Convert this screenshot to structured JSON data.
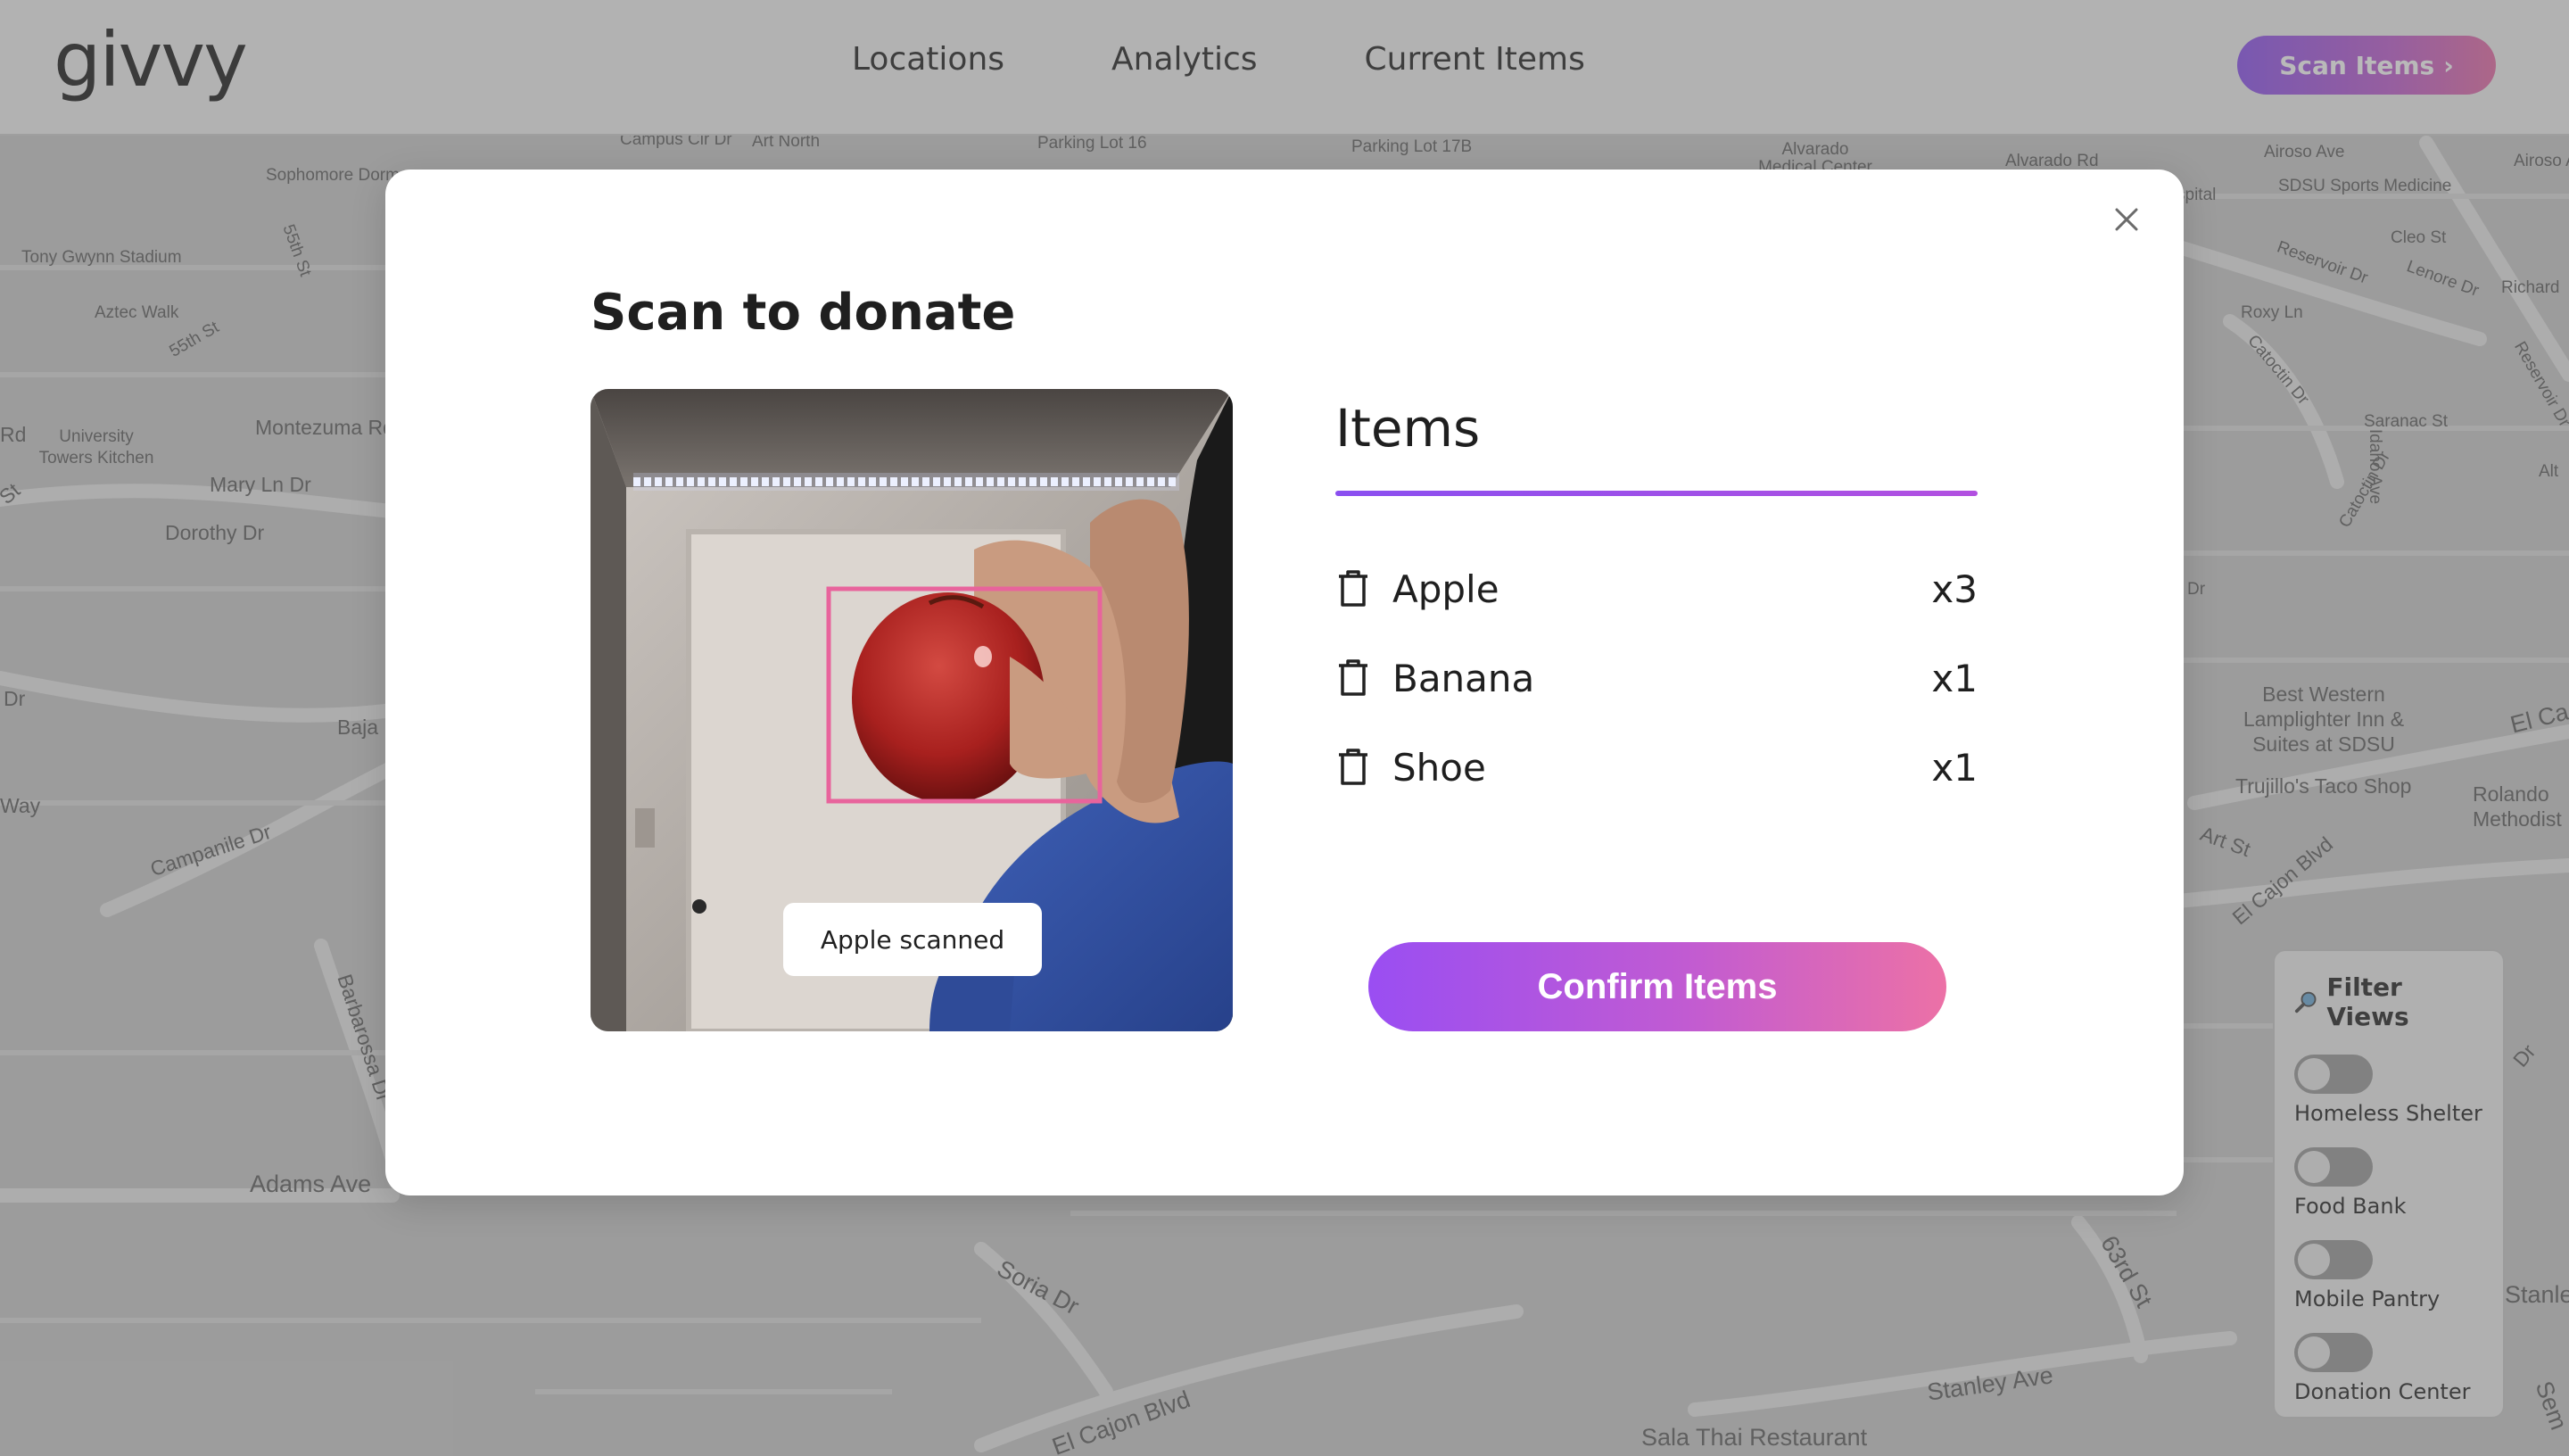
{
  "app": {
    "logo": "givvy"
  },
  "nav": {
    "items": [
      {
        "label": "Locations"
      },
      {
        "label": "Analytics"
      },
      {
        "label": "Current Items"
      }
    ]
  },
  "header": {
    "scan_button": "Scan Items",
    "scan_button_chevron": "›"
  },
  "map": {
    "labels": [
      "Campus Cir Dr",
      "Art North",
      "Parking Lot 16",
      "Parking Lot 17B",
      "Alvarado Medical Center",
      "Alvarado Rd",
      "Airoso Ave",
      "Airoso Ave",
      "Sophomore Dorm",
      "Tony Gwynn Stadium",
      "55th St",
      "Aztec Walk",
      "55th St",
      "University Towers Kitchen",
      "Montezuma Rd",
      "Mary Ln Dr",
      "Dorothy Dr",
      "Rd",
      "St",
      "Dr",
      "Way",
      "Baja Dr",
      "Campanile Dr",
      "Barbarossa Dr",
      "Adams Ave",
      "Soria Dr",
      "El Cajon Blvd",
      "Stanley Ave",
      "Sala Thai Restaurant",
      "63rd St",
      "SDSU Sports Medicine",
      "Cleo St",
      "Reservoir Dr",
      "Lenore Dr",
      "Richard",
      "Roxy Ln",
      "Catoctin Dr",
      "Saranac St",
      "Catoctin Dr",
      "Idaho Ave",
      "Reservoir Dr",
      "Alt",
      "Dr",
      "Best Western Lamplighter Inn & Suites at SDSU",
      "Trujillo's Taco Shop",
      "El Ca",
      "Rolando Methodist",
      "Art St",
      "El Cajon Blvd",
      "Dr",
      "Stanley",
      "Sem",
      "spital"
    ]
  },
  "filter": {
    "title": "Filter Views",
    "items": [
      {
        "label": "Homeless Shelter",
        "on": false
      },
      {
        "label": "Food Bank",
        "on": false
      },
      {
        "label": "Mobile Pantry",
        "on": false
      },
      {
        "label": "Donation Center",
        "on": false
      }
    ]
  },
  "modal": {
    "title": "Scan to donate",
    "toast": "Apple scanned",
    "items_heading": "Items",
    "items": [
      {
        "name": "Apple",
        "qty": "x3"
      },
      {
        "name": "Banana",
        "qty": "x1"
      },
      {
        "name": "Shoe",
        "qty": "x1"
      }
    ],
    "confirm_label": "Confirm Items"
  },
  "colors": {
    "accent_purple": "#8a4ff0",
    "accent_pink": "#e86aa6",
    "detection_box": "#e8649c"
  }
}
